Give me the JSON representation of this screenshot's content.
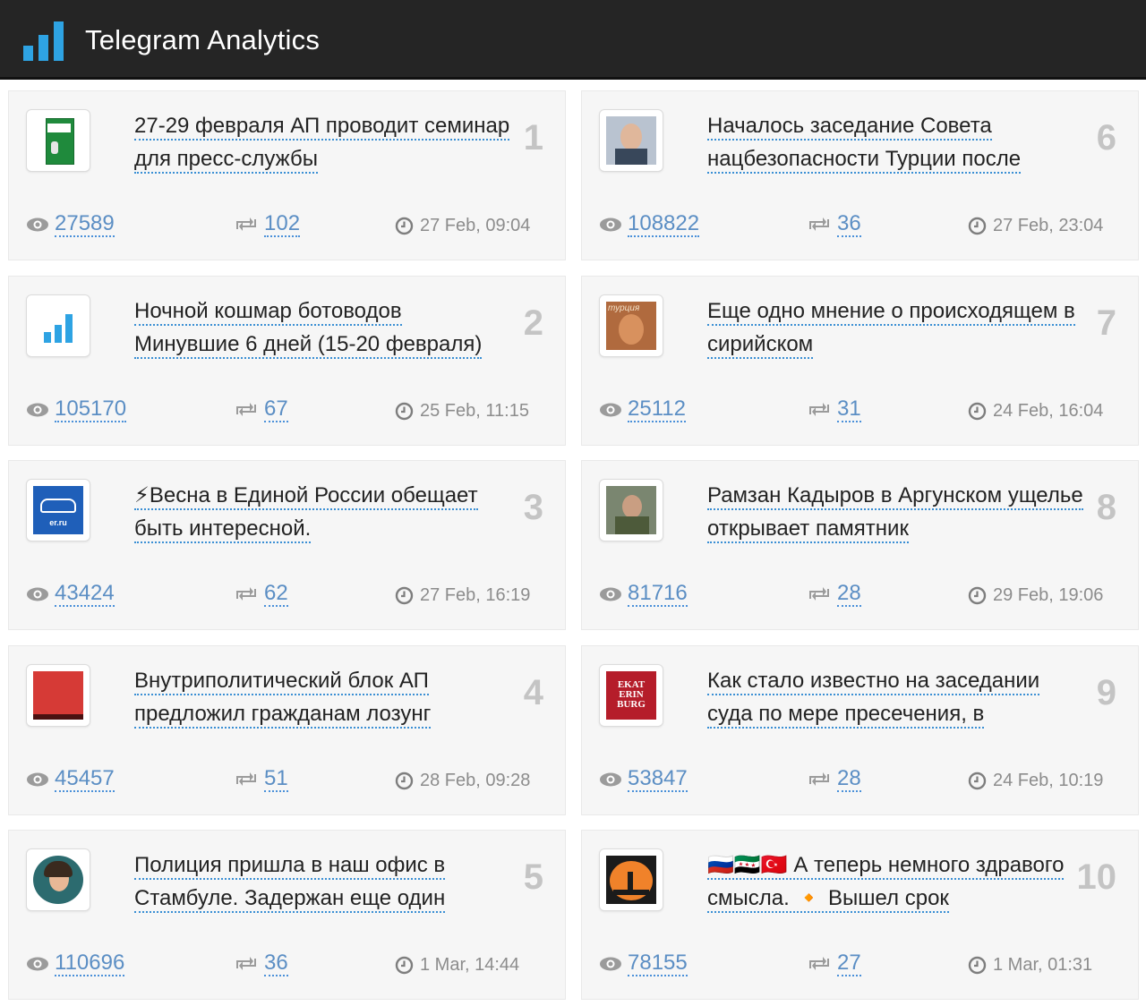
{
  "header": {
    "title": "Telegram Analytics",
    "logo_icon": "bar-chart-icon",
    "accent": "#2ea3e3"
  },
  "posts": [
    {
      "rank": "1",
      "title": "27-29 февраля АП проводит семинар для пресс-службы",
      "views": "27589",
      "shares": "102",
      "time": "27 Feb, 09:04",
      "thumb": "green-binder"
    },
    {
      "rank": "2",
      "title": "Ночной кошмар ботоводов Минувшие 6 дней (15-20 февраля)",
      "views": "105170",
      "shares": "67",
      "time": "25 Feb, 11:15",
      "thumb": "bar-chart-logo"
    },
    {
      "rank": "3",
      "title": "⚡Весна в Единой России обещает быть интересной.",
      "views": "43424",
      "shares": "62",
      "time": "27 Feb, 16:19",
      "thumb": "er-ru-logo",
      "thumb_text": "er.ru"
    },
    {
      "rank": "4",
      "title": "Внутриполитический блок АП предложил гражданам лозунг",
      "views": "45457",
      "shares": "51",
      "time": "28 Feb, 09:28",
      "thumb": "red-square"
    },
    {
      "rank": "5",
      "title": "Полиция пришла в наш офис в Стамбуле. Задержан еще один",
      "views": "110696",
      "shares": "36",
      "time": "1 Mar, 14:44",
      "thumb": "woman-portrait"
    },
    {
      "rank": "6",
      "title": "Началось заседание Совета нацбезопасности Турции после",
      "views": "108822",
      "shares": "36",
      "time": "27 Feb, 23:04",
      "thumb": "man-portrait"
    },
    {
      "rank": "7",
      "title": "Еще одно мнение о происходящем в сирийском",
      "views": "25112",
      "shares": "31",
      "time": "24 Feb, 16:04",
      "thumb": "turkey-portrait",
      "thumb_text": "турция"
    },
    {
      "rank": "8",
      "title": "Рамзан Кадыров в Аргунском ущелье открывает памятник",
      "views": "81716",
      "shares": "28",
      "time": "29 Feb, 19:06",
      "thumb": "man-outdoor"
    },
    {
      "rank": "9",
      "title": "Как стало известно на заседании суда по мере пресечения, в",
      "views": "53847",
      "shares": "28",
      "time": "24 Feb, 10:19",
      "thumb": "ekaterinburg-logo",
      "thumb_text": "EKAT ERIN BURG"
    },
    {
      "rank": "10",
      "title": "🇷🇺🇸🇾🇹🇷 А теперь немного здравого смысла. 🔸 Вышел срок",
      "views": "78155",
      "shares": "27",
      "time": "1 Mar, 01:31",
      "thumb": "sunset-fisherman"
    }
  ]
}
